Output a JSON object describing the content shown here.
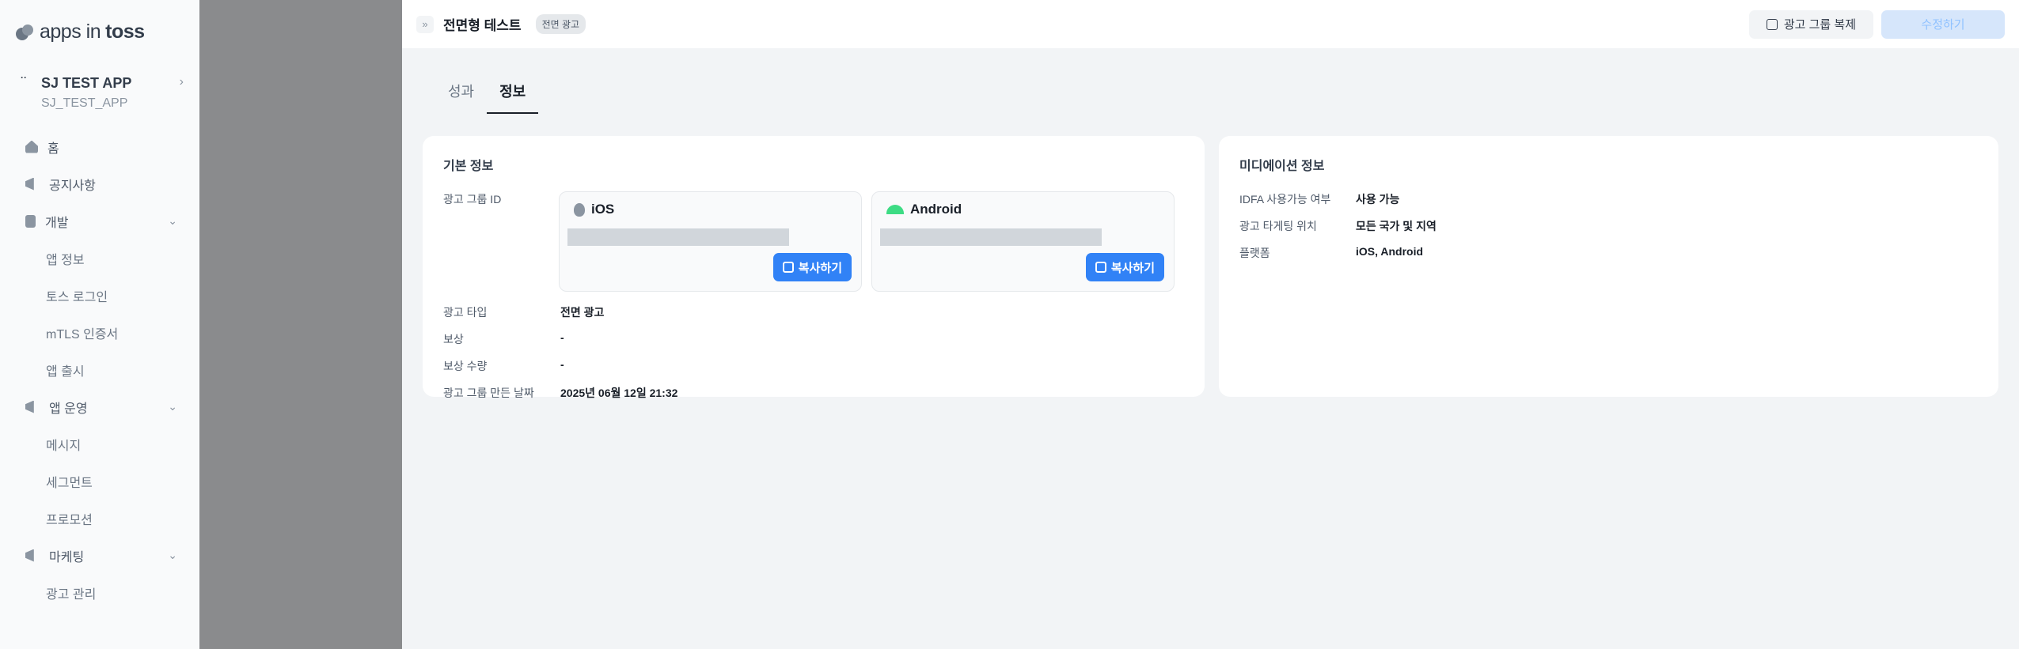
{
  "sidebar": {
    "logo": {
      "text_light": "apps in ",
      "text_bold": "toss"
    },
    "app": {
      "name": "SJ TEST APP",
      "id": "SJ_TEST_APP"
    },
    "items": [
      {
        "label": "홈",
        "icon": "home-icon"
      },
      {
        "label": "공지사항",
        "icon": "megaphone-icon"
      },
      {
        "label": "개발",
        "icon": "document-icon",
        "expandable": true
      },
      {
        "label": "앱 정보",
        "sub": true
      },
      {
        "label": "토스 로그인",
        "sub": true
      },
      {
        "label": "mTLS 인증서",
        "sub": true
      },
      {
        "label": "앱 출시",
        "sub": true
      },
      {
        "label": "앱 운영",
        "icon": "megaphone-icon",
        "expandable": true
      },
      {
        "label": "메시지",
        "sub": true
      },
      {
        "label": "세그먼트",
        "sub": true
      },
      {
        "label": "프로모션",
        "sub": true
      },
      {
        "label": "마케팅",
        "icon": "megaphone-icon",
        "expandable": true
      },
      {
        "label": "광고 관리",
        "sub": true
      }
    ]
  },
  "topbar": {
    "title": "전면형 테스트",
    "badge": "전면 광고",
    "copy_group_label": "광고 그룹 복제",
    "edit_label": "수정하기"
  },
  "tabs": [
    {
      "label": "성과",
      "active": false
    },
    {
      "label": "정보",
      "active": true
    }
  ],
  "basic_info": {
    "title": "기본 정보",
    "ad_group_id_label": "광고 그룹 ID",
    "platforms": [
      {
        "name": "iOS",
        "icon": "apple-icon",
        "copy_label": "복사하기"
      },
      {
        "name": "Android",
        "icon": "android-icon",
        "copy_label": "복사하기"
      }
    ],
    "rows": [
      {
        "key": "광고 타입",
        "value": "전면 광고"
      },
      {
        "key": "보상",
        "value": "-"
      },
      {
        "key": "보상 수량",
        "value": "-"
      },
      {
        "key": "광고 그룹 만든 날짜",
        "value": "2025년 06월 12일 21:32"
      }
    ]
  },
  "mediation_info": {
    "title": "미디에이션 정보",
    "rows": [
      {
        "key": "IDFA 사용가능 여부",
        "value": "사용 가능"
      },
      {
        "key": "광고 타게팅 위치",
        "value": "모든 국가 및 지역"
      },
      {
        "key": "플랫폼",
        "value": "iOS, Android"
      }
    ]
  },
  "colors": {
    "primary": "#3182f6",
    "overlay": "#8a8b8d",
    "panel_bg": "#f2f4f6"
  }
}
